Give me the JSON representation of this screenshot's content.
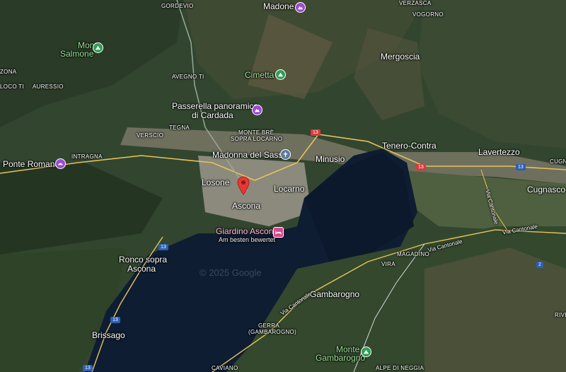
{
  "map": {
    "watermark": "© 2025 Google",
    "towns": {
      "madone": "Madone",
      "mergoscia": "Mergoscia",
      "cimetta": "Cimetta",
      "monte_salmone_1": "Monte",
      "monte_salmone_2": "Salmone",
      "passerella_1": "Passerella panoramica",
      "passerella_2": "di Cardada",
      "madonna_del_sasso": "Madonna del Sasso",
      "ponte_romano": "Ponte Romano",
      "losone": "Losone",
      "ascona": "Ascona",
      "locarno": "Locarno",
      "minusio": "Minusio",
      "tenero_contra": "Tenero-Contra",
      "lavertezzo": "Lavertezzo",
      "cugnasco": "Cugnasco-G",
      "giardino_ascona": "Giardino Ascona",
      "giardino_sub": "Am besten bewertet",
      "ronco_1": "Ronco sopra",
      "ronco_2": "Ascona",
      "gambarogno": "Gambarogno",
      "brissago": "Brissago",
      "monte_gambarogno_1": "Monte",
      "monte_gambarogno_2": "Gambarogno"
    },
    "small_labels": {
      "gordevio": "GORDEVIO",
      "vogorno": "VOGORNO",
      "verzasca": "VERZASCA",
      "avegno": "AVEGNO TI",
      "zona": "ZONA",
      "loco": "LOCO TI",
      "auressio": "AURESSIO",
      "verscio": "VERSCIO",
      "tegna": "TEGNA",
      "monte_bre_1": "MONTE BRÈ",
      "monte_bre_2": "SOPRA LOCARNO",
      "intragna": "INTRAGNA",
      "magadino": "MAGADINO",
      "vira": "VIRA",
      "gerra_1": "GERRA",
      "gerra_2": "(GAMBAROGNO)",
      "caviano": "CAVIANO",
      "alpe_di_neggia": "ALPE DI NEGGIA",
      "cugn": "CUGN",
      "riv": "RIVE"
    },
    "roads": {
      "via_cantonale": "Via Cantonale",
      "via_cantonale_2": "Via Cantonale",
      "via_cantonale_3": "Via Cantonale",
      "via_cantonale_4": "Via Cantonale",
      "r13": "13",
      "r2": "2"
    },
    "colors": {
      "lake": "#0f1d33",
      "forest": "#2f4a30",
      "urban": "#8c8a7c",
      "marker": "#e53935",
      "road": "#e6c35a"
    }
  }
}
